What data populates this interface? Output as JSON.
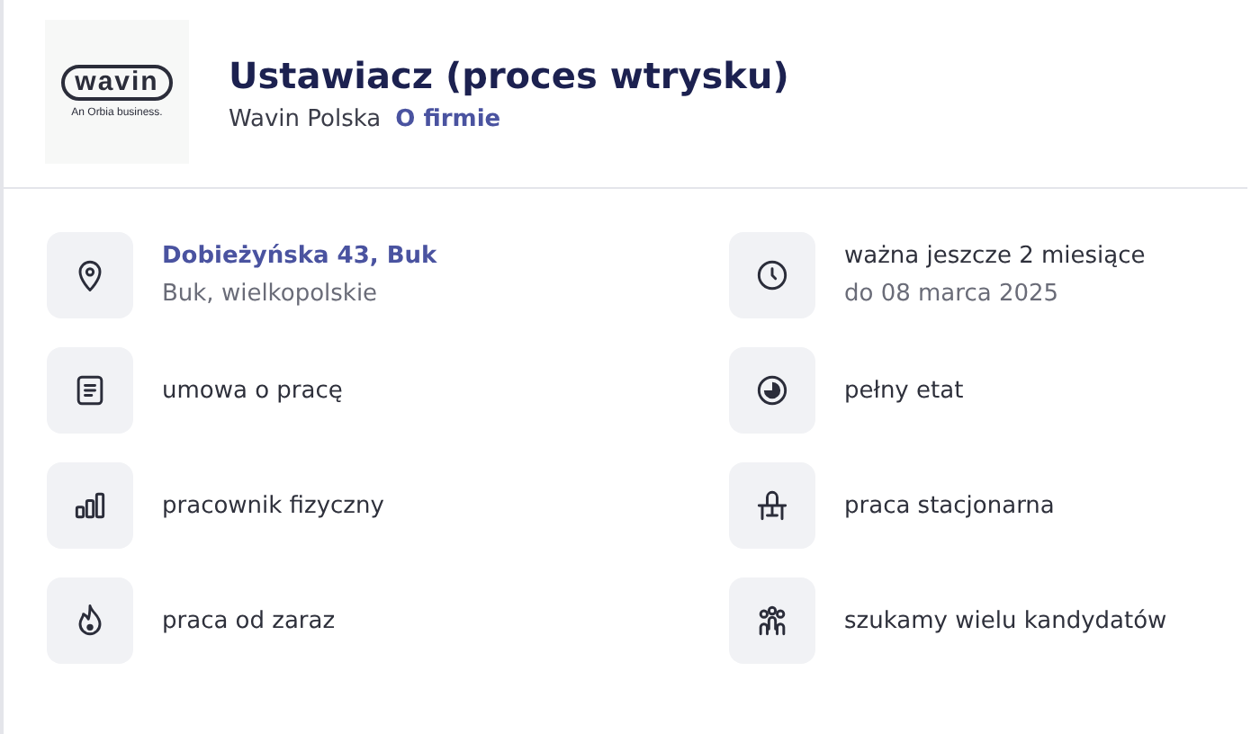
{
  "logo": {
    "wordmark": "wavin",
    "tagline": "An Orbia business."
  },
  "title": "Ustawiacz (proces wtrysku)",
  "company": {
    "name": "Wavin Polska",
    "link": "O firmie"
  },
  "details": [
    {
      "kind": "location",
      "primary": "Dobieżyńska 43, Buk",
      "secondary": "Buk, wielkopolskie",
      "link": true
    },
    {
      "kind": "clock",
      "primary": "ważna jeszcze 2 miesiące",
      "secondary": "do 08 marca 2025",
      "link": false
    },
    {
      "kind": "document",
      "primary": "umowa o pracę",
      "link": false
    },
    {
      "kind": "pie",
      "primary": "pełny etat",
      "link": false
    },
    {
      "kind": "bars",
      "primary": "pracownik fizyczny",
      "link": false
    },
    {
      "kind": "desk",
      "primary": "praca stacjonarna",
      "link": false
    },
    {
      "kind": "flame",
      "primary": "praca od zaraz",
      "link": false
    },
    {
      "kind": "people",
      "primary": "szukamy wielu kandydatów",
      "link": false
    }
  ]
}
